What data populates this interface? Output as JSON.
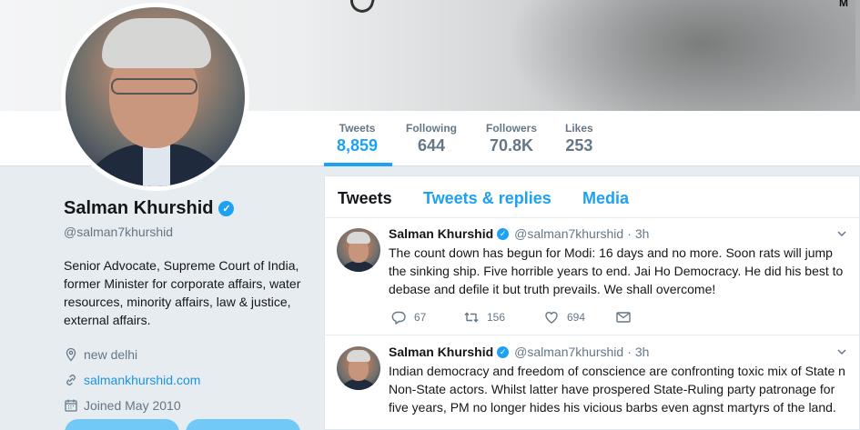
{
  "banner": {
    "mark": "M"
  },
  "nav": {
    "stats": [
      {
        "label": "Tweets",
        "value": "8,859",
        "active": true
      },
      {
        "label": "Following",
        "value": "644"
      },
      {
        "label": "Followers",
        "value": "70.8K"
      },
      {
        "label": "Likes",
        "value": "253"
      }
    ]
  },
  "profile": {
    "name": "Salman Khurshid",
    "verified": "✓",
    "handle": "@salman7khurshid",
    "bio": "Senior Advocate, Supreme Court of India, former Minister for corporate affairs, water resources, minority affairs, law & justice, external affairs.",
    "location": "new delhi",
    "website": "salmankhurshid.com",
    "joined": "Joined May 2010"
  },
  "timeline": {
    "tabs": [
      "Tweets",
      "Tweets & replies",
      "Media"
    ],
    "tweets": [
      {
        "name": "Salman Khurshid",
        "handle": "@salman7khurshid",
        "sep": "·",
        "time": "3h",
        "text": "The count down has begun for Modi: 16 days and no more. Soon rats will jump\nthe sinking ship. Five horrible years to end. Jai Ho Democracy. He did his best to\ndebase and defile it but truth prevails. We shall overcome!",
        "replies": "67",
        "retweets": "156",
        "likes": "694"
      },
      {
        "name": "Salman Khurshid",
        "handle": "@salman7khurshid",
        "sep": "·",
        "time": "3h",
        "text": "Indian democracy and freedom of conscience are confronting toxic mix of State n\nNon-State actors. Whilst latter have prospered State-Ruling party patronage for\nfive years,  PM no longer hides his vicious barbs even agnst martyrs of the land.",
        "replies": "",
        "retweets": "",
        "likes": ""
      }
    ]
  },
  "colors": {
    "accent": "#1da1f2",
    "text": "#14171a",
    "muted": "#657786",
    "background": "#e6ecf0"
  }
}
